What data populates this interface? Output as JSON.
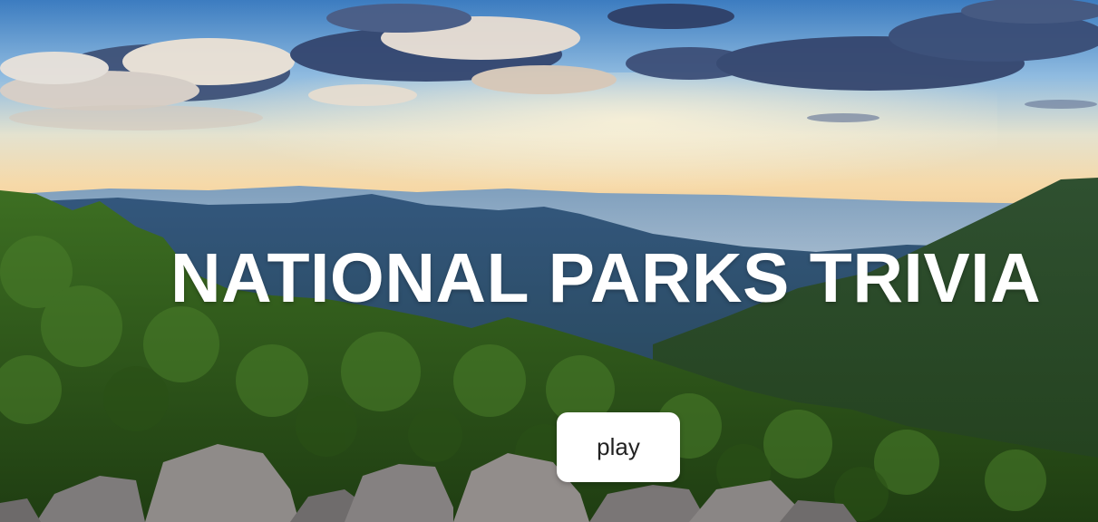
{
  "title": "NATIONAL PARKS TRIVIA",
  "play_button": {
    "label": "play"
  },
  "background": {
    "description_icon": "mountain-landscape",
    "colors": {
      "sky_top": "#3f7fc0",
      "sky_horizon": "#f4dcae",
      "cloud": "#e9ddd0",
      "cloud_shadow": "#3d4f78",
      "ridge_far": "#5f7f9f",
      "ridge_mid": "#2d4f72",
      "forest": "#2f5a1c",
      "rock": "#8a8585"
    }
  },
  "colors": {
    "title_text": "#ffffff",
    "button_bg": "#ffffff",
    "button_text": "#222222"
  }
}
